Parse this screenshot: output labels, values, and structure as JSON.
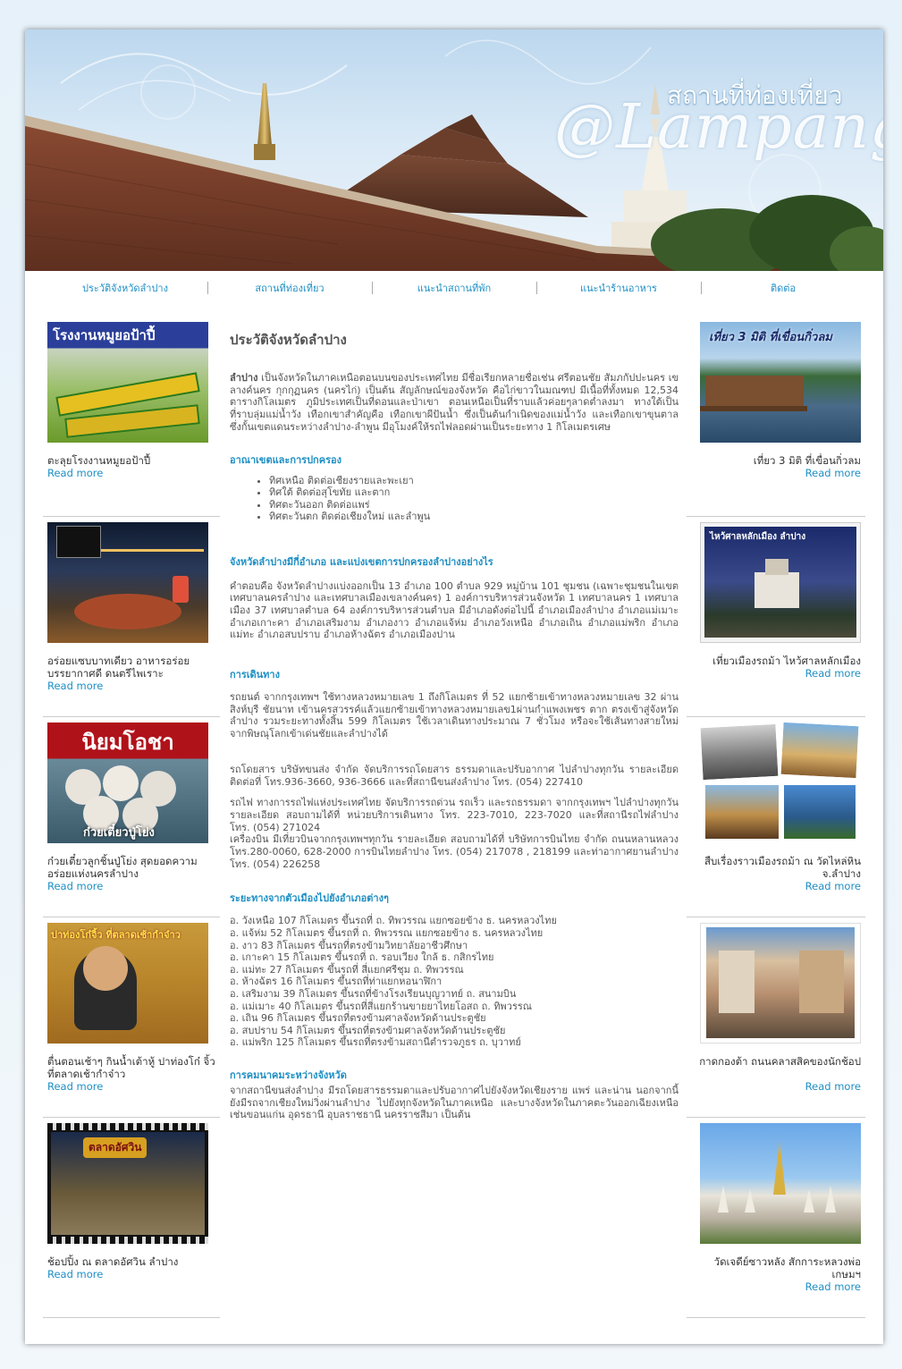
{
  "header": {
    "title": "สถานที่ท่องเที่ยว",
    "script_text": "@Lampang"
  },
  "nav": [
    "ประวัติจังหวัดลำปาง",
    "สถานที่ท่องเที่ยว",
    "แนะนำสถานที่พัก",
    "แนะนำร้านอาหาร",
    "ติดต่อ"
  ],
  "left_cards": [
    {
      "caption": "ตะลุยโรงงานหมูยอป้าปี้",
      "image_text": "โรงงานหมูยอป้าปี้",
      "read_more": "Read more"
    },
    {
      "caption": "อร่อยแซบบาทเดียว อาหารอร่อย บรรยากาศดี ดนตรีไพเราะ",
      "image_text": "",
      "read_more": "Read more"
    },
    {
      "caption": "ก๋วยเตี๋ยวลูกชิ้นปู่โย่ง สุดยอดความอร่อยแห่งนครลำปาง",
      "image_text": "นิยมโอชา",
      "image_text2": "ก๋วยเตี๋ยวปู่โย่ง",
      "read_more": "Read more"
    },
    {
      "caption": "ตื่นตอนเช้าๆ กินน้ำเต้าหู้ ปาท่องโก๋ จิ้ว ที่ตลาดเช้ากำจ๋าว",
      "image_text": "ปาท่องโก๋จิ้ว ที่ตลาดเช้ากำจ๋าว",
      "read_more": "Read more"
    },
    {
      "caption": "ช้อปปิ้ง ณ ตลาดอัศวิน ลำปาง",
      "image_text": "ตลาดอัศวิน",
      "read_more": "Read more"
    }
  ],
  "right_cards": [
    {
      "caption": "เที่ยว 3 มิติ ที่เขื่อนกิ่วลม",
      "image_text": "เที่ยว 3 มิติ ที่เขื่อนกิ่วลม",
      "read_more": "Read more"
    },
    {
      "caption": "เที่ยวเมืองรถม้า ไหว้ศาลหลักเมือง",
      "image_text": "ไหว้ศาลหลักเมือง ลำปาง",
      "read_more": "Read more"
    },
    {
      "caption": "สืบเรื่องราวเมืองรถม้า ณ วัดไหล่หิน จ.ลำปาง",
      "image_text": "",
      "read_more": "Read more"
    },
    {
      "caption": "กาดกองต้า ถนนคลาสสิคของนักช้อป",
      "image_text": "",
      "read_more": "Read more"
    },
    {
      "caption": "วัดเจดีย์ซาวหลัง สักการะหลวงพ่อเกษมฯ",
      "image_text": "",
      "read_more": "Read more"
    }
  ],
  "main": {
    "title": "ประวัติจังหวัดลำปาง",
    "intro_bold": "ลำปาง",
    "intro": " เป็นจังหวัดในภาคเหนือตอนบนของประเทศไทย มีชื่อเรียกหลายชื่อเช่น ศรีตอนชัย สัมภกัปปะนคร เขลางค์นคร กุกกุฏนคร (นครไก่) เป็นต้น สัญลักษณ์ของจังหวัด คือไก่ขาวในมณฑป มีเนื้อที่ทั้งหมด 12,534 ตารางกิโลเมตร ภูมิประเทศเป็นที่ดอนและป่าเขา ตอนเหนือเป็นที่ราบแล้วค่อยๆลาดต่ำลงมา ทางใต้เป็นที่ราบลุ่มแม่น้ำวัง เทือกเขาสำคัญคือ เทือกเขาผีปันน้ำ ซึ่งเป็นต้นกำเนิดของแม่น้ำวัง และเทือกเขาขุนตาล ซึ่งกั้นเขตแดนระหว่างลำปาง-ลำพูน มีอุโมงค์ให้รถไฟลอดผ่านเป็นระยะทาง 1 กิโลเมตรเศษ",
    "h_territory": "อาณาเขตและการปกครอง",
    "territory": [
      "ทิศเหนือ ติดต่อเชียงรายและพะเยา",
      "ทิศใต้ ติดต่อสุโขทัย และตาก",
      "ทิศตะวันออก ติดต่อแพร่",
      "ทิศตะวันตก ติดต่อเชียงใหม่ และลำพูน"
    ],
    "h_districts": "จังหวัดลำปางมีกี่อำเภอ และแบ่งเขตการปกครองลำปางอย่างไร",
    "districts": "คำตอบคือ จังหวัดลำปางแบ่งออกเป็น 13 อำเภอ 100 ตำบล 929 หมู่บ้าน 101 ชุมชน (เฉพาะชุมชนในเขตเทศบาลนครลำปาง และเทศบาลเมืองเขลางค์นคร) 1 องค์การบริหารส่วนจังหวัด 1 เทศบาลนคร 1 เทศบาลเมือง 37 เทศบาลตำบล 64 องค์การบริหารส่วนตำบล มีอำเภอดังต่อไปนี้ อำเภอเมืองลำปาง อำเภอแม่เมาะ อำเภอเกาะคา อำเภอเสริมงาม อำเภองาว อำเภอแจ้ห่ม อำเภอวังเหนือ อำเภอเถิน อำเภอแม่พริก อำเภอแม่ทะ อำเภอสบปราบ อำเภอห้างฉัตร อำเภอเมืองปาน",
    "h_travel": "การเดินทาง",
    "travel_car": "รถยนต์ จากกรุงเทพฯ ใช้ทางหลวงหมายเลข 1 ถึงกิโลเมตร ที่ 52 แยกซ้ายเข้าทางหลวงหมายเลข 32 ผ่านสิงห์บุรี ชัยนาท เข้านครสวรรค์แล้วแยกซ้ายเข้าทางหลวงหมายเลข1ผ่านกำแพงเพชร ตาก ตรงเข้าสู่จังหวัดลำปาง รวมระยะทางทั้งสิ้น 599 กิโลเมตร ใช้เวลาเดินทางประมาณ 7 ชั่วโมง หรือจะใช้เส้นทางสายใหม่จากพิษณุโลกเข้าเด่นชัยและลำปางได้",
    "travel_bus": "รถโดยสาร บริษัทขนส่ง จำกัด จัดบริการรถโดยสาร ธรรมดาและปรับอากาศ ไปลำปางทุกวัน รายละเอียดติดต่อที่ โทร.936-3660, 936-3666 และที่สถานีขนส่งลำปาง โทร. (054) 227410",
    "travel_train": "รถไฟ ทางการรถไฟแห่งประเทศไทย จัดบริการรถด่วน รถเร็ว และรถธรรมดา จากกรุงเทพฯ ไปลำปางทุกวัน รายละเอียด สอบถามได้ที่ หน่วยบริการเดินทาง โทร. 223-7010, 223-7020 และที่สถานีรถไฟลำปาง โทร. (054) 271024",
    "travel_plane": "เครื่องบิน มีเที่ยวบินจากกรุงเทพฯทุกวัน รายละเอียด สอบถามได้ที่ บริษัทการบินไทย จำกัด ถนนหลานหลวง โทร.280-0060, 628-2000 การบินไทยลำปาง โทร. (054) 217078 , 218199 และท่าอากาศยานลำปาง โทร. (054) 226258",
    "h_distance": "ระยะทางจากตัวเมืองไปยังอำเภอต่างๆ",
    "distances": [
      "อ. วังเหนือ 107 กิโลเมตร ขึ้นรถที่ ถ. ทิพวรรณ แยกซอยข้าง ธ. นครหลวงไทย",
      "อ. แจ้ห่ม 52 กิโลเมตร ขึ้นรถที่ ถ. ทิพวรรณ แยกซอยข้าง ธ. นครหลวงไทย",
      "อ. งาว 83 กิโลเมตร ขึ้นรถที่ตรงข้ามวิทยาลัยอาชีวศึกษา",
      "อ. เกาะคา 15 กิโลเมตร ขึ้นรถที่ ถ. รอบเวียง ใกล้ ธ. กสิกรไทย",
      "อ. แม่ทะ 27 กิโลเมตร ขึ้นรถที่ สี่แยกศรีชุม ถ. ทิพวรรณ",
      "อ. ห้างฉัตร 16 กิโลเมตร ขึ้นรถที่ท่าแยกหอนาฬิกา",
      "อ. เสริมงาม 39 กิโลเมตร ขึ้นรถที่ข้างโรงเรียนบุญวาทย์ ถ. สนามบิน",
      "อ. แม่เมาะ 40 กิโลเมตร ขึ้นรถที่สี่แยกร้านขายยาไทยโอสถ ถ. ทิพวรรณ",
      "อ. เถิน 96 กิโลเมตร ขึ้นรถที่ตรงข้ามศาลจังหวัดด้านประตูชัย",
      "อ. สบปราบ 54 กิโลเมตร ขึ้นรถที่ตรงข้ามศาลจังหวัดด้านประตูชัย",
      "อ. แม่พริก 125 กิโลเมตร ขึ้นรถที่ตรงข้ามสถานีตำรวจภูธร ถ. บุวาทย์"
    ],
    "h_transport": "การคมนาคมระหว่างจังหวัด",
    "transport": "จากสถานีขนส่งลำปาง มีรถโดยสารธรรมดาและปรับอากาศไปยังจังหวัดเชียงราย แพร่ และน่าน นอกจากนี้ยังมีรถจากเชียงใหม่วิ่งผ่านลำปาง ไปยังทุกจังหวัดในภาคเหนือ และบางจังหวัดในภาคตะวันออกเฉียงเหนือ เช่นขอนแก่น อุดรธานี อุบลราชธานี นครราชสีมา เป็นต้น"
  },
  "colors": {
    "link": "#1e8fc5",
    "text": "#555555",
    "page_bg": "#ffffff"
  }
}
